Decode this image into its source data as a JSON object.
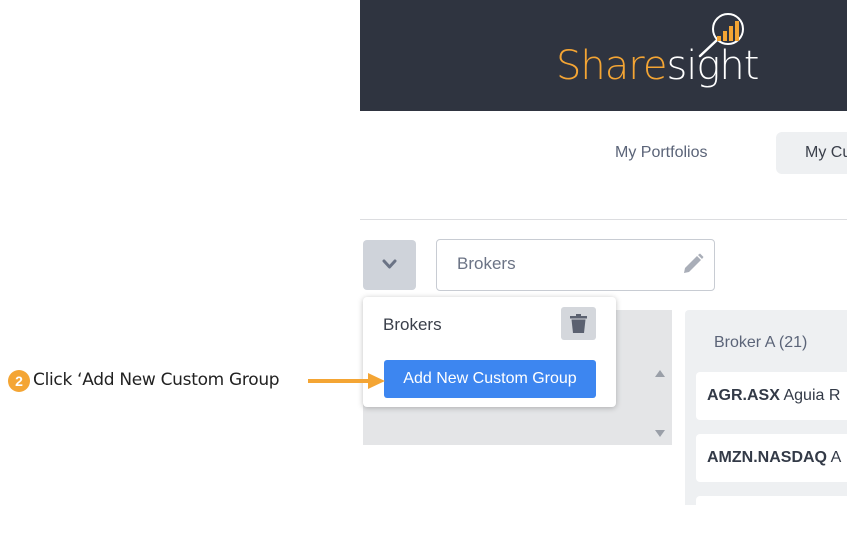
{
  "header": {
    "logo_part1": "Share",
    "logo_part2": "sight",
    "logo_icon": "magnifier-chart-icon",
    "background": "#2f3440",
    "accent": "#f4a534"
  },
  "nav": {
    "my_portfolios": "My Portfolios",
    "my_custom": "My Cu"
  },
  "custom_group": {
    "toggle_icon": "chevron-down-icon",
    "name_value": "Brokers",
    "edit_icon": "pencil-icon"
  },
  "dropdown": {
    "group_label": "Brokers",
    "delete_icon": "trash-icon",
    "add_button_label": "Add New Custom Group",
    "add_button_color": "#3d86f0"
  },
  "broker_column": {
    "title": "Broker A (21)",
    "holdings": [
      {
        "code": "AGR.ASX",
        "name": "Aguia R"
      },
      {
        "code": "AMZN.NASDAQ",
        "name": "A"
      }
    ]
  },
  "annotation": {
    "step_number": "2",
    "text": "Click ‘Add New Custom Group",
    "color": "#f4a534"
  }
}
